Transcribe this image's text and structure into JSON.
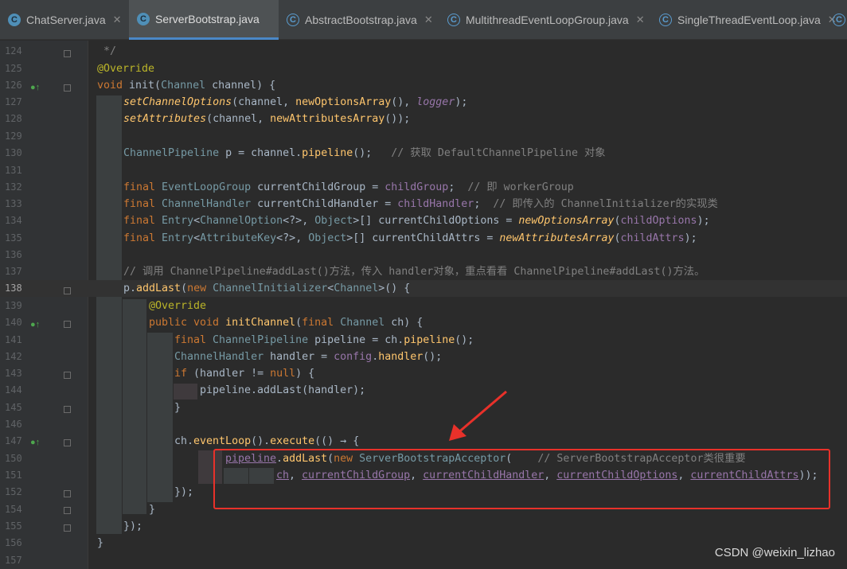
{
  "tabs": [
    {
      "label": "ChatServer.java",
      "icon": "class-icon"
    },
    {
      "label": "ServerBootstrap.java",
      "icon": "class-icon",
      "active": true
    },
    {
      "label": "AbstractBootstrap.java",
      "icon": "abstract-class-icon"
    },
    {
      "label": "MultithreadEventLoopGroup.java",
      "icon": "abstract-class-icon"
    },
    {
      "label": "SingleThreadEventLoop.java",
      "icon": "abstract-class-icon"
    }
  ],
  "lines": [
    {
      "n": "124",
      "tokens": [
        [
          "c",
          " */"
        ]
      ]
    },
    {
      "n": "125",
      "tokens": [
        [
          "a",
          "@Override"
        ]
      ]
    },
    {
      "n": "126",
      "tokens": [
        [
          "k",
          "void "
        ],
        [
          "t",
          "init("
        ],
        [
          "y",
          "Channel"
        ],
        [
          "t",
          " channel) {"
        ]
      ]
    },
    {
      "n": "127",
      "tokens": [
        [
          "mi",
          "setChannelOptions"
        ],
        [
          "t",
          "(channel, "
        ],
        [
          "m",
          "newOptionsArray"
        ],
        [
          "t",
          "(), "
        ],
        [
          "fi",
          "logger"
        ],
        [
          "t",
          ");"
        ]
      ]
    },
    {
      "n": "128",
      "tokens": [
        [
          "mi",
          "setAttributes"
        ],
        [
          "t",
          "(channel, "
        ],
        [
          "m",
          "newAttributesArray"
        ],
        [
          "t",
          "());"
        ]
      ]
    },
    {
      "n": "129",
      "tokens": []
    },
    {
      "n": "130",
      "tokens": [
        [
          "y",
          "ChannelPipeline"
        ],
        [
          "t",
          " p = channel."
        ],
        [
          "m",
          "pipeline"
        ],
        [
          "t",
          "();   "
        ],
        [
          "c",
          "// 获取 DefaultChannelPipeline 对象"
        ]
      ]
    },
    {
      "n": "131",
      "tokens": []
    },
    {
      "n": "132",
      "tokens": [
        [
          "k",
          "final "
        ],
        [
          "y",
          "EventLoopGroup"
        ],
        [
          "t",
          " currentChildGroup = "
        ],
        [
          "f",
          "childGroup"
        ],
        [
          "t",
          ";  "
        ],
        [
          "c",
          "// 即 workerGroup"
        ]
      ]
    },
    {
      "n": "133",
      "tokens": [
        [
          "k",
          "final "
        ],
        [
          "y",
          "ChannelHandler"
        ],
        [
          "t",
          " currentChildHandler = "
        ],
        [
          "f",
          "childHandler"
        ],
        [
          "t",
          ";  "
        ],
        [
          "c",
          "// 即传入的 ChannelInitializer的实现类"
        ]
      ]
    },
    {
      "n": "134",
      "tokens": [
        [
          "k",
          "final "
        ],
        [
          "y",
          "Entry"
        ],
        [
          "t",
          "<"
        ],
        [
          "y",
          "ChannelOption"
        ],
        [
          "t",
          "<?>, "
        ],
        [
          "y",
          "Object"
        ],
        [
          "t",
          ">[] currentChildOptions = "
        ],
        [
          "mi",
          "newOptionsArray"
        ],
        [
          "t",
          "("
        ],
        [
          "f",
          "childOptions"
        ],
        [
          "t",
          ");"
        ]
      ]
    },
    {
      "n": "135",
      "tokens": [
        [
          "k",
          "final "
        ],
        [
          "y",
          "Entry"
        ],
        [
          "t",
          "<"
        ],
        [
          "y",
          "AttributeKey"
        ],
        [
          "t",
          "<?>, "
        ],
        [
          "y",
          "Object"
        ],
        [
          "t",
          ">[] currentChildAttrs = "
        ],
        [
          "mi",
          "newAttributesArray"
        ],
        [
          "t",
          "("
        ],
        [
          "f",
          "childAttrs"
        ],
        [
          "t",
          ");"
        ]
      ]
    },
    {
      "n": "136",
      "tokens": []
    },
    {
      "n": "137",
      "tokens": [
        [
          "c",
          "// 调用 ChannelPipeline#addLast()方法，传入 handler对象，重点看看 ChannelPipeline#addLast()方法。"
        ]
      ]
    },
    {
      "n": "138",
      "tokens": [
        [
          "t",
          "p."
        ],
        [
          "m",
          "addLast"
        ],
        [
          "t",
          "("
        ],
        [
          "k",
          "new "
        ],
        [
          "y",
          "ChannelInitializer"
        ],
        [
          "t",
          "<"
        ],
        [
          "y",
          "Channel"
        ],
        [
          "t",
          ">() {"
        ]
      ]
    },
    {
      "n": "139",
      "tokens": [
        [
          "a",
          "@Override"
        ]
      ]
    },
    {
      "n": "140",
      "tokens": [
        [
          "k",
          "public void "
        ],
        [
          "m",
          "initChannel"
        ],
        [
          "t",
          "("
        ],
        [
          "k",
          "final "
        ],
        [
          "y",
          "Channel"
        ],
        [
          "t",
          " ch) {"
        ]
      ]
    },
    {
      "n": "141",
      "tokens": [
        [
          "k",
          "final "
        ],
        [
          "y",
          "ChannelPipeline"
        ],
        [
          "t",
          " pipeline = ch."
        ],
        [
          "m",
          "pipeline"
        ],
        [
          "t",
          "();"
        ]
      ]
    },
    {
      "n": "142",
      "tokens": [
        [
          "y",
          "ChannelHandler"
        ],
        [
          "t",
          " handler = "
        ],
        [
          "f",
          "config"
        ],
        [
          "t",
          "."
        ],
        [
          "m",
          "handler"
        ],
        [
          "t",
          "();"
        ]
      ]
    },
    {
      "n": "143",
      "tokens": [
        [
          "k",
          "if "
        ],
        [
          "t",
          "(handler != "
        ],
        [
          "k",
          "null"
        ],
        [
          "t",
          ") {"
        ]
      ]
    },
    {
      "n": "144",
      "tokens": [
        [
          "t",
          "pipeline.addLast(handler);"
        ]
      ]
    },
    {
      "n": "145",
      "tokens": [
        [
          "t",
          "}"
        ]
      ]
    },
    {
      "n": "146",
      "tokens": []
    },
    {
      "n": "147",
      "tokens": [
        [
          "t",
          "ch."
        ],
        [
          "m",
          "eventLoop"
        ],
        [
          "t",
          "()."
        ],
        [
          "m",
          "execute"
        ],
        [
          "t",
          "(() → {"
        ]
      ]
    },
    {
      "n": "150",
      "tokens": [
        [
          "fu",
          "pipeline"
        ],
        [
          "t",
          "."
        ],
        [
          "m",
          "addLast"
        ],
        [
          "t",
          "("
        ],
        [
          "k",
          "new "
        ],
        [
          "y",
          "ServerBootstrapAcceptor"
        ],
        [
          "t",
          "(    "
        ],
        [
          "c",
          "// ServerBootstrapAcceptor类很重要"
        ]
      ]
    },
    {
      "n": "151",
      "tokens": [
        [
          "fu",
          "ch"
        ],
        [
          "t",
          ", "
        ],
        [
          "fu",
          "currentChildGroup"
        ],
        [
          "t",
          ", "
        ],
        [
          "fu",
          "currentChildHandler"
        ],
        [
          "t",
          ", "
        ],
        [
          "fu",
          "currentChildOptions"
        ],
        [
          "t",
          ", "
        ],
        [
          "fu",
          "currentChildAttrs"
        ],
        [
          "t",
          "));"
        ]
      ]
    },
    {
      "n": "152",
      "tokens": [
        [
          "t",
          "});"
        ]
      ]
    },
    {
      "n": "154",
      "tokens": [
        [
          "t",
          "}"
        ]
      ]
    },
    {
      "n": "155",
      "tokens": [
        [
          "t",
          "});"
        ]
      ]
    },
    {
      "n": "156",
      "tokens": [
        [
          "t",
          "}"
        ]
      ]
    },
    {
      "n": "157",
      "tokens": []
    }
  ],
  "watermark": "CSDN @weixin_lizhao",
  "colors": {
    "accent_tab": "#4a88c7",
    "annotation_box": "#e8312a"
  }
}
